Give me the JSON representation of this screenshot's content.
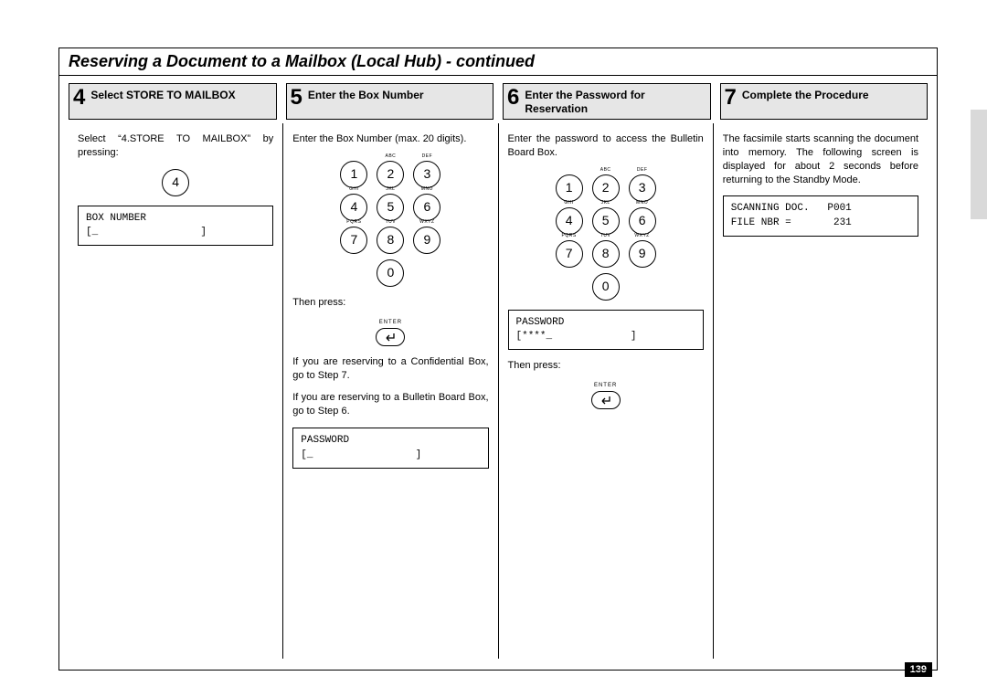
{
  "page_number": "139",
  "title": "Reserving a Document to a Mailbox (Local Hub) - continued",
  "keypad_letters": {
    "2": "ABC",
    "3": "DEF",
    "4": "GHI",
    "5": "JKL",
    "6": "MNO",
    "7": "PQRS",
    "8": "TUV",
    "9": "WXYZ"
  },
  "enter_label": "ENTER",
  "steps": {
    "s4": {
      "num": "4",
      "title": "Select STORE TO MAILBOX",
      "body1": "Select “4.STORE TO MAILBOX” by pressing:",
      "lcd": "BOX NUMBER\n[_                 ]"
    },
    "s5": {
      "num": "5",
      "title": "Enter the Box Number",
      "body1": "Enter the Box Number (max. 20 digits).",
      "then": "Then press:",
      "body2": "If you are reserving to a Confidential Box, go to Step 7.",
      "body3": "If you are reserving to a Bulletin Board Box, go to Step 6.",
      "lcd": "PASSWORD\n[_                 ]"
    },
    "s6": {
      "num": "6",
      "title": "Enter the Password for Reservation",
      "body1": "Enter the password to access the Bulletin Board Box.",
      "lcd": "PASSWORD\n[****_             ]",
      "then": "Then press:"
    },
    "s7": {
      "num": "7",
      "title": "Complete the Procedure",
      "body1": "The facsimile starts scanning the document into memory.  The following screen is displayed for about 2 seconds before returning to the Standby Mode.",
      "lcd": "SCANNING DOC.   P001\nFILE NBR =       231"
    }
  }
}
